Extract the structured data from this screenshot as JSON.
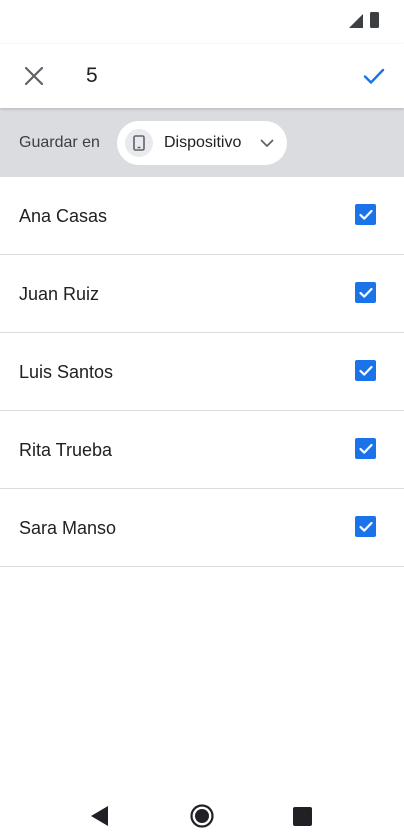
{
  "status_bar": {
    "icons": [
      "signal-icon",
      "battery-icon"
    ]
  },
  "app_bar": {
    "close_icon": "close-icon",
    "selected_count": "5",
    "confirm_icon": "check-icon"
  },
  "save_bar": {
    "label": "Guardar en",
    "chip": {
      "icon": "smartphone-icon",
      "label": "Dispositivo",
      "arrow_icon": "chevron-down-icon"
    }
  },
  "contacts": [
    {
      "name": "Ana Casas",
      "checked": true
    },
    {
      "name": "Juan Ruiz",
      "checked": true
    },
    {
      "name": "Luis Santos",
      "checked": true
    },
    {
      "name": "Rita Trueba",
      "checked": true
    },
    {
      "name": "Sara Manso",
      "checked": true
    }
  ],
  "nav_bar": {
    "icons": [
      "back-icon",
      "home-icon",
      "recents-icon"
    ]
  },
  "colors": {
    "accent": "#1a73e8",
    "save_bar_bg": "#dadce0",
    "divider": "#dadce0"
  }
}
